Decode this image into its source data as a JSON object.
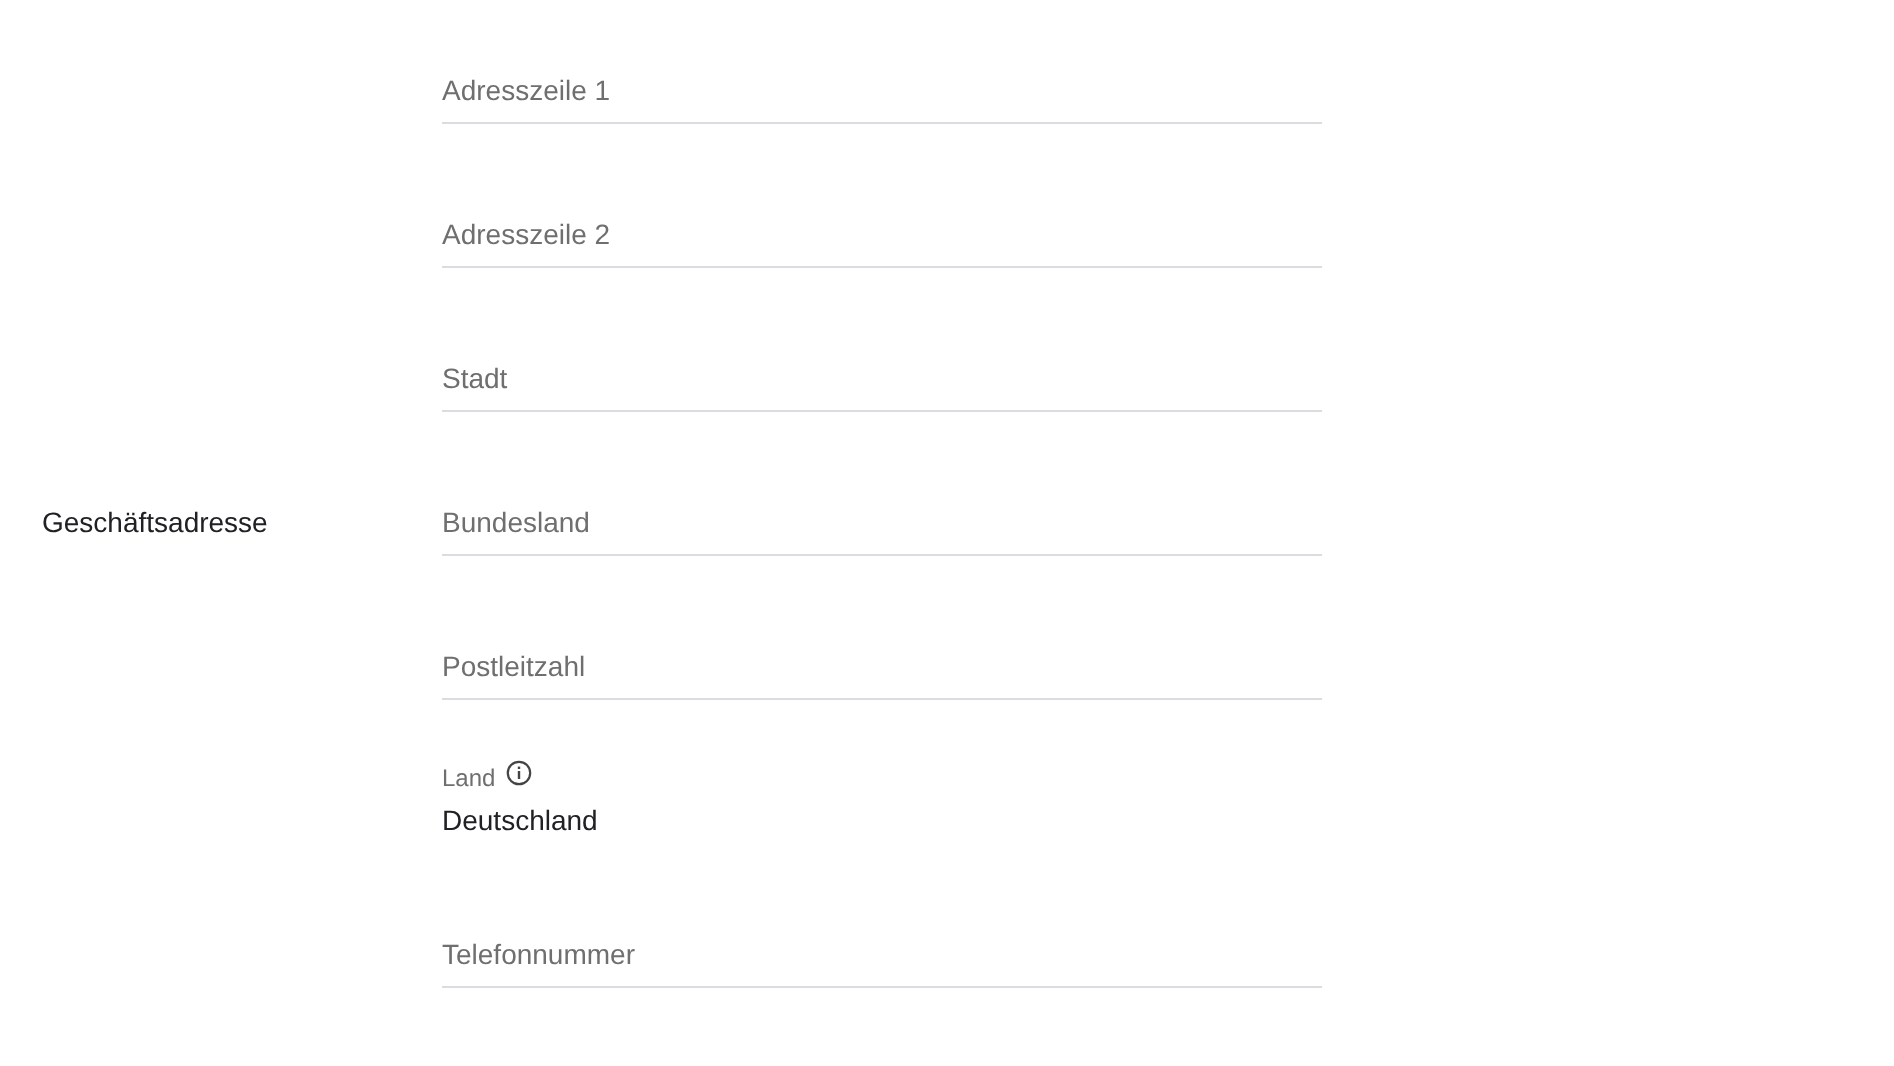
{
  "section_label": "Geschäftsadresse",
  "fields": [
    {
      "kind": "input",
      "placeholder": "Adresszeile 1"
    },
    {
      "kind": "input",
      "placeholder": "Adresszeile 2"
    },
    {
      "kind": "input",
      "placeholder": "Stadt"
    },
    {
      "kind": "input",
      "placeholder": "Bundesland"
    },
    {
      "kind": "input",
      "placeholder": "Postleitzahl"
    },
    {
      "kind": "static",
      "label": "Land",
      "value": "Deutschland"
    },
    {
      "kind": "input",
      "placeholder": "Telefonnummer"
    }
  ]
}
